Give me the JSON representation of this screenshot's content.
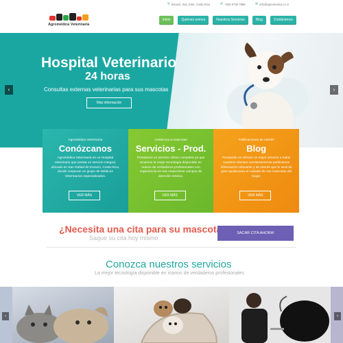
{
  "topbar": {
    "address": "Escazú, San José, Costa Rica",
    "phone": "+506 8728 7898",
    "email": "info@agromedica.co.cr"
  },
  "logo": {
    "brand": "Agromédica Veterinaria"
  },
  "nav": {
    "items": [
      {
        "label": "Inicio"
      },
      {
        "label": "Quiénes somos"
      },
      {
        "label": "Nuestros Servicios"
      },
      {
        "label": "Blog"
      },
      {
        "label": "Contáctenos"
      }
    ]
  },
  "hero": {
    "title": "Hospital Veterinario",
    "subtitle": "24 horas",
    "description": "Consultas externas veterinarias para sus mascotas",
    "button": "Más información",
    "prev": "‹",
    "next": "›"
  },
  "cards": [
    {
      "kicker": "Agromédica Veterinaria",
      "title": "Conózcanos",
      "text": "Agromédica Veterinaria es un Hospital Veterinario que presta un servicio integral, ubicado en San Rafael de Escazú, Costa Rica, donde cooperan un grupo de Médicos Veterinarios especializados.",
      "button": "VER MÁS",
      "color": "#2ab7ad"
    },
    {
      "kicker": "Asistencia a mascotas",
      "title": "Servicios - Prod.",
      "text": "Prestamos un servicio clínico completo ya que tenemos la mejor tecnología disponible en manos de verdaderos profesionales con experiencia en sus respectivos campos de atención médica.",
      "button": "VER MÁS",
      "color": "#86c932"
    },
    {
      "kicker": "Publicaciones de interés",
      "title": "Blog",
      "text": "Pensando en ofrecer un mejor servicio a todos nuestros clientes constantemente publicamos información relevante y de interés que le será de gran ayuda para el cuidado de sus mascotas del hogar.",
      "button": "VER MÁS",
      "color": "#f5a21b"
    }
  ],
  "appointment": {
    "question": "¿Necesita una cita para su mascota?",
    "subtext": "Saque su cita hoy mismo",
    "button": "SACAR CITA AHORA!"
  },
  "services": {
    "title": "Conozca nuestros servicios",
    "subtitle": "La mejor tecnología disponible en manos de verdaderos profesionales",
    "prev": "‹",
    "next": "›"
  },
  "colors": {
    "teal": "#1aa7a2",
    "green": "#86c932",
    "orange": "#f5a21b",
    "purple": "#6d5fb3",
    "red": "#e25a4e"
  }
}
